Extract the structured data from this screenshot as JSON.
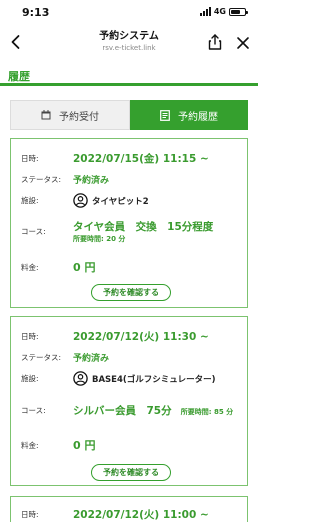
{
  "status_bar": {
    "time": "9:13",
    "network": "4G"
  },
  "browser": {
    "title": "予約システム",
    "url": "rsv.e-ticket.link"
  },
  "section": {
    "title": "履歴"
  },
  "tabs": [
    {
      "label": "予約受付",
      "active": false,
      "icon": "calendar-icon"
    },
    {
      "label": "予約履歴",
      "active": true,
      "icon": "document-icon"
    }
  ],
  "labels": {
    "datetime": "日時:",
    "status": "ステータス:",
    "facility": "施設:",
    "course": "コース:",
    "fee": "料金:"
  },
  "reservations": [
    {
      "datetime": "2022/07/15(金) 11:15 ~",
      "status": "予約済み",
      "facility": "タイヤピット2",
      "course": "タイヤ会員　交換　15分程度",
      "duration": "所要時間: 20 分",
      "fee": "0 円",
      "button": "予約を確認する"
    },
    {
      "datetime": "2022/07/12(火) 11:30 ~",
      "status": "予約済み",
      "facility": "BASE4(ゴルフシミュレーター)",
      "course": "シルバー会員　75分",
      "duration": "所要時間: 85 分",
      "fee": "0 円",
      "button": "予約を確認する"
    },
    {
      "datetime": "2022/07/12(火) 11:00 ~"
    }
  ],
  "colors": {
    "accent": "#35a02e",
    "card_border": "#7cc36f",
    "tab_inactive": "#f0f0f0"
  }
}
